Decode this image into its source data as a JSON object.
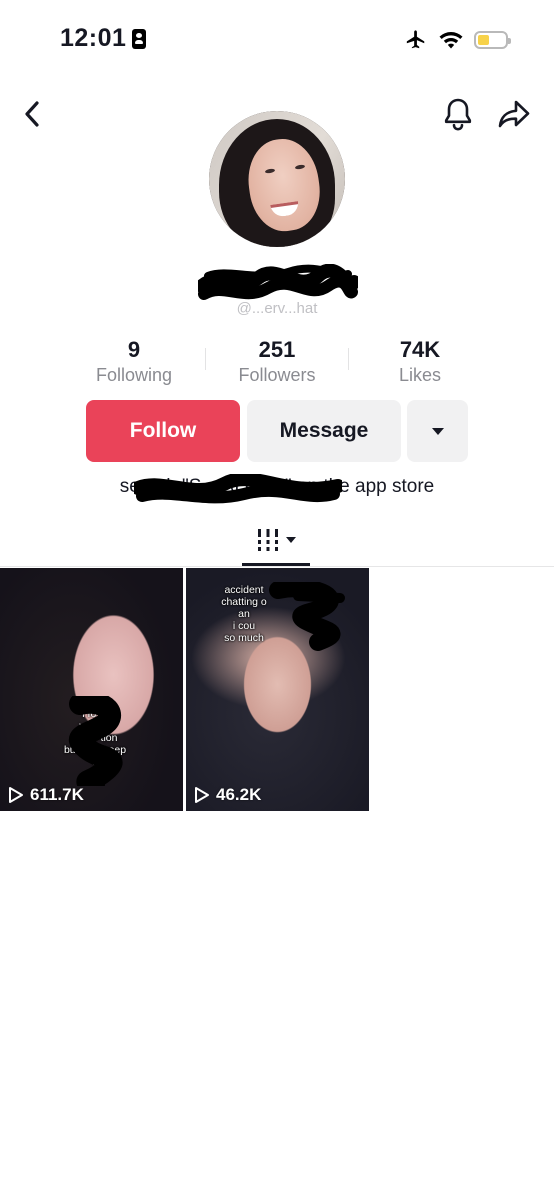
{
  "status_bar": {
    "time": "12:01"
  },
  "profile": {
    "display_name": "",
    "handle": "@...erv...hat"
  },
  "stats": [
    {
      "value": "9",
      "label": "Following"
    },
    {
      "value": "251",
      "label": "Followers"
    },
    {
      "value": "74K",
      "label": "Likes"
    }
  ],
  "actions": {
    "follow_label": "Follow",
    "message_label": "Message"
  },
  "bio": {
    "text": "search \"S...  AI Chat\" on the app store"
  },
  "videos": [
    {
      "caption": "\"i fo          ter\nvers           ut\nfilters          tion\nbut i'm          ekeep\nit",
      "views": "611.7K"
    },
    {
      "caption": "accident\nchatting o\nan\ni cou\nso much",
      "views": "46.2K"
    }
  ],
  "colors": {
    "follow": "#ea4359",
    "secondary_button": "#f1f1f2",
    "battery": "#f7d24a"
  },
  "icons": {
    "back": "chevron-left-icon",
    "bell": "bell-icon",
    "share": "share-arrow-icon",
    "more": "caret-down-icon",
    "grid": "grid-bars-icon",
    "play": "play-outline-icon"
  }
}
